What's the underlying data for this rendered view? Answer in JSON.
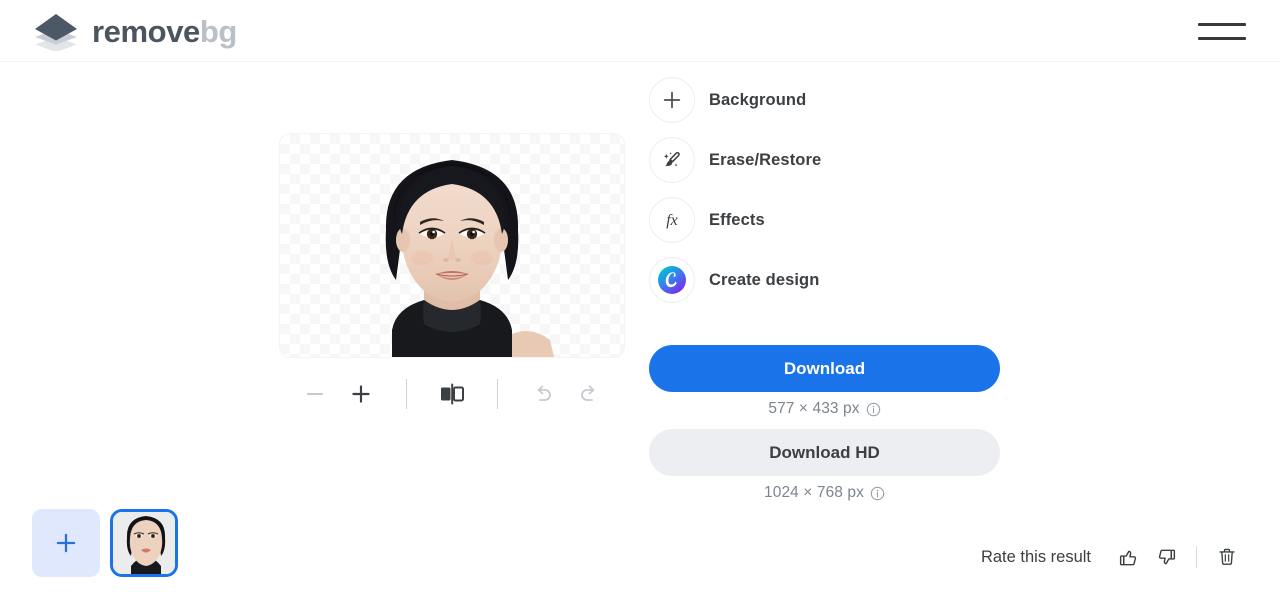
{
  "header": {
    "logo_icon": "layers-icon",
    "brand_primary": "remove",
    "brand_secondary": "bg",
    "menu_icon": "hamburger-menu-icon"
  },
  "canvas": {
    "image_alt": "portrait-with-transparent-background",
    "toolbar": {
      "zoom_out_icon": "minus-icon",
      "zoom_in_icon": "plus-icon",
      "compare_icon": "before-after-compare-icon",
      "undo_icon": "undo-arrow-icon",
      "redo_icon": "redo-arrow-icon"
    }
  },
  "thumbnails": {
    "add_icon": "plus-icon",
    "items": [
      {
        "name": "uploaded-portrait-thumbnail",
        "selected": true
      }
    ]
  },
  "tools": [
    {
      "label": "Background",
      "icon": "plus-circle-icon"
    },
    {
      "label": "Erase/Restore",
      "icon": "magic-brush-icon"
    },
    {
      "label": "Effects",
      "icon": "fx-icon"
    },
    {
      "label": "Create design",
      "icon": "canva-logo-icon"
    }
  ],
  "download": {
    "primary_label": "Download",
    "primary_dimensions": "577 × 433 px",
    "hd_label": "Download HD",
    "hd_dimensions": "1024 × 768 px",
    "info_icon": "info-circle-icon"
  },
  "rate": {
    "label": "Rate this result",
    "thumbs_up_icon": "thumbs-up-icon",
    "thumbs_down_icon": "thumbs-down-icon",
    "delete_icon": "trash-icon"
  },
  "colors": {
    "accent_blue": "#1a73e8",
    "brand_dark": "#4a5560",
    "brand_light": "#b9c0c8",
    "secondary_button": "#eceef1",
    "muted_text": "#7d858e"
  }
}
